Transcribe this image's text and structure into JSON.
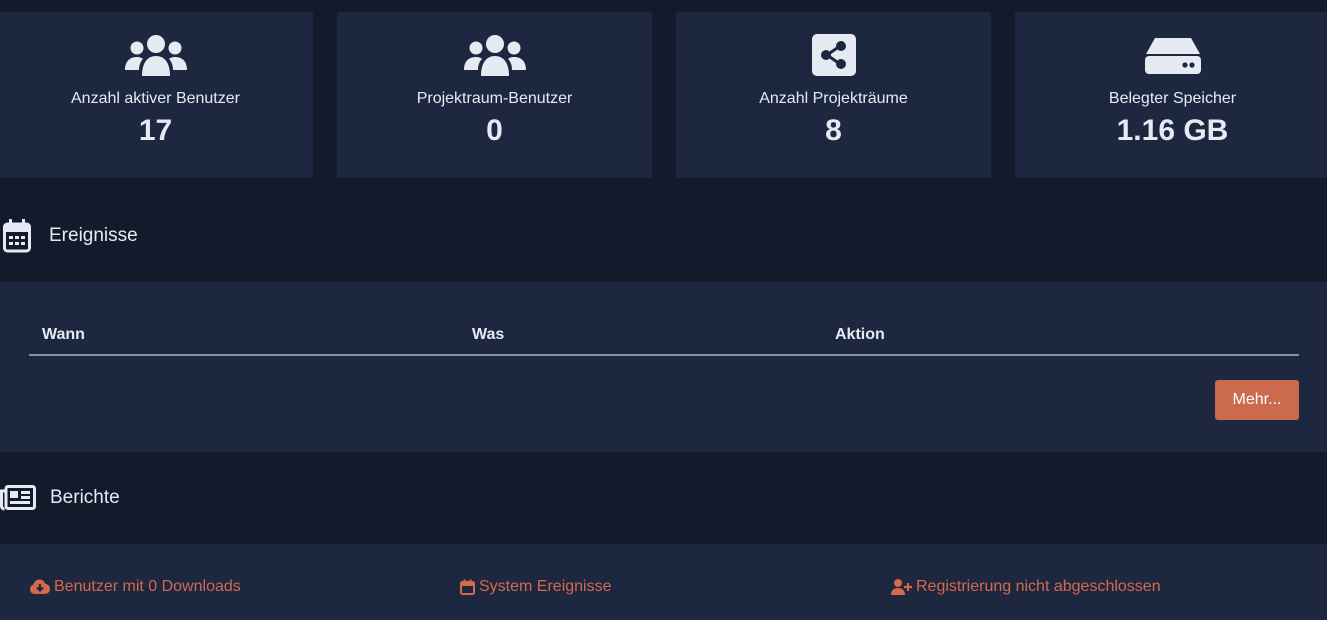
{
  "stats": [
    {
      "icon": "users-icon",
      "label": "Anzahl aktiver Benutzer",
      "value": "17"
    },
    {
      "icon": "users-icon",
      "label": "Projektraum-Benutzer",
      "value": "0"
    },
    {
      "icon": "share-icon",
      "label": "Anzahl Projekträume",
      "value": "8"
    },
    {
      "icon": "hard-drive-icon",
      "label": "Belegter Speicher",
      "value": "1.16 GB"
    }
  ],
  "events": {
    "icon": "calendar-icon",
    "title": "Ereignisse",
    "columns": [
      "Wann",
      "Was",
      "Aktion"
    ],
    "more_label": "Mehr..."
  },
  "reports": {
    "icon": "newspaper-icon",
    "title": "Berichte",
    "links": [
      {
        "icon": "cloud-download-icon",
        "label": "Benutzer mit 0 Downloads"
      },
      {
        "icon": "calendar-icon",
        "label": "System Ereignisse"
      },
      {
        "icon": "user-plus-icon",
        "label": "Registrierung nicht abgeschlossen"
      }
    ]
  },
  "colors": {
    "background": "#131a2b",
    "panel": "#1d2740",
    "text": "#e6eaf2",
    "accent": "#cc6a4d",
    "link": "#d4694c"
  }
}
